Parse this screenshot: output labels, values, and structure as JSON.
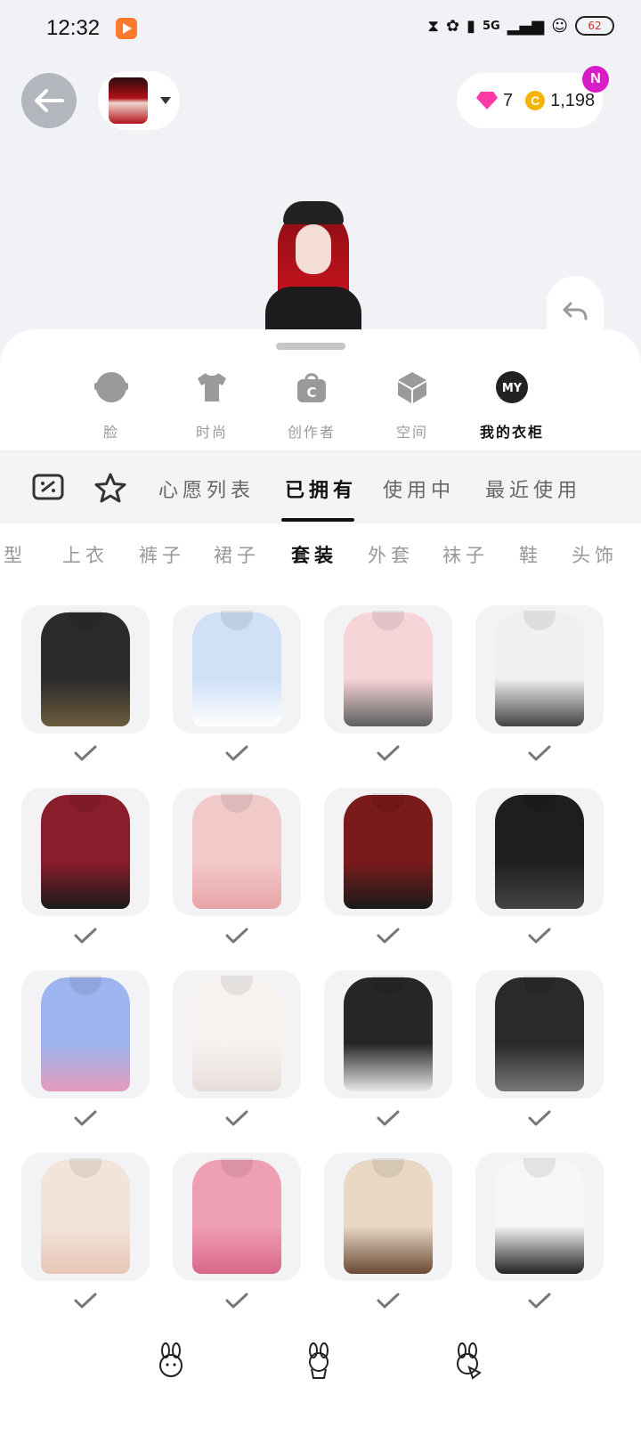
{
  "status_bar": {
    "time": "12:32",
    "network": "5G",
    "battery": "62"
  },
  "header": {
    "gems": "7",
    "coins": "1,198",
    "badge": "N"
  },
  "categories": [
    {
      "label": "脸",
      "icon": "face-icon"
    },
    {
      "label": "时尚",
      "icon": "shirt-icon"
    },
    {
      "label": "创作者",
      "icon": "creator-bag-icon"
    },
    {
      "label": "空间",
      "icon": "cube-icon"
    },
    {
      "label": "我的衣柜",
      "icon": "my-wardrobe-icon",
      "icon_text": "MY"
    }
  ],
  "sub_tabs": [
    "心愿列表",
    "已拥有",
    "使用中",
    "最近使用"
  ],
  "type_tabs": [
    "发型",
    "上衣",
    "裤子",
    "裙子",
    "套装",
    "外套",
    "袜子",
    "鞋",
    "头饰"
  ],
  "items": [
    {
      "name": "gothic-black-corset-outfit",
      "color": "#2b2b2b",
      "accent": "#6b5c3c",
      "owned": true
    },
    {
      "name": "blue-maid-dress-outfit",
      "color": "#cfe0f7",
      "accent": "#ffffff",
      "owned": true
    },
    {
      "name": "pink-sweater-plaid-skirt-outfit",
      "color": "#f7d4d8",
      "accent": "#5e5e5e",
      "owned": true
    },
    {
      "name": "white-hoodie-denim-outfit",
      "color": "#f0f0f0",
      "accent": "#444444",
      "owned": true
    },
    {
      "name": "red-off-shoulder-outfit",
      "color": "#8a1d2b",
      "accent": "#1a1a1a",
      "owned": true
    },
    {
      "name": "pink-lace-gown-outfit",
      "color": "#f2c9c9",
      "accent": "#e7a4a8",
      "owned": true
    },
    {
      "name": "red-floral-kimono-outfit",
      "color": "#7a1b1b",
      "accent": "#1a1a1a",
      "owned": true
    },
    {
      "name": "black-long-sleeve-outfit",
      "color": "#1e1e1e",
      "accent": "#444444",
      "owned": true
    },
    {
      "name": "striped-cat-sweater-outfit",
      "color": "#9db4ef",
      "accent": "#e59bbb",
      "owned": true
    },
    {
      "name": "white-fur-dress-outfit",
      "color": "#f7f2f0",
      "accent": "#e6dedb",
      "owned": true
    },
    {
      "name": "black-jacket-tie-outfit",
      "color": "#262626",
      "accent": "#e8e8e8",
      "owned": true
    },
    {
      "name": "tweed-tiered-skirt-outfit",
      "color": "#2a2a2a",
      "accent": "#777777",
      "owned": true
    },
    {
      "name": "fur-satin-dress-outfit",
      "color": "#f2e4da",
      "accent": "#e7c6b6",
      "owned": true
    },
    {
      "name": "pink-plaid-outfit",
      "color": "#ef9fb4",
      "accent": "#d9678a",
      "owned": true
    },
    {
      "name": "beige-knit-outfit",
      "color": "#e8d8c4",
      "accent": "#6b4a35",
      "owned": true
    },
    {
      "name": "white-ruffle-dress-outfit",
      "color": "#f7f7f7",
      "accent": "#222222",
      "owned": true
    }
  ],
  "bottom_nav": [
    "bunny-icon",
    "bunny-cup-icon",
    "bunny-gift-icon"
  ]
}
